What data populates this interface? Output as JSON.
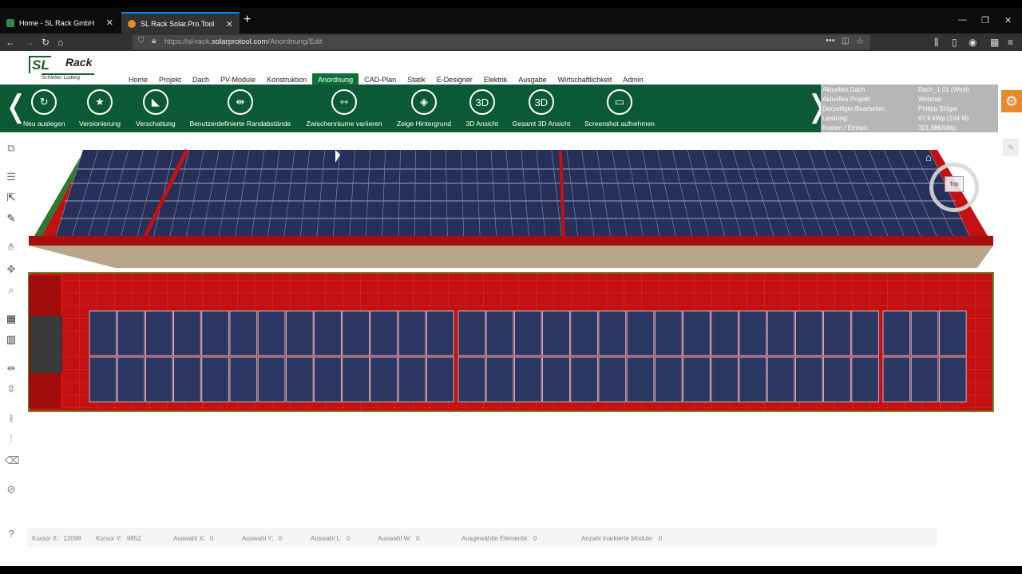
{
  "browser": {
    "tabs": [
      {
        "title": "Home - SL Rack GmbH",
        "close": "✕"
      },
      {
        "title": "SL Rack Solar.Pro.Tool",
        "close": "✕"
      }
    ],
    "new_tab": "+",
    "url_prefix": "https://sl-rack.",
    "url_domain": "solarprotool.com",
    "url_path": "/Anordnung/Edit"
  },
  "logo": {
    "brand": "SL",
    "brand2": "Rack",
    "sub": "Schletter Ludwig"
  },
  "menu": [
    "Home",
    "Projekt",
    "Dach",
    "PV-Module",
    "Konstruktion",
    "Anordnung",
    "CAD-Plan",
    "Statik",
    "E-Designer",
    "Elektrik",
    "Ausgabe",
    "Wirtschaftlichkeit",
    "Admin"
  ],
  "menu_active": "Anordnung",
  "toolbar": {
    "left_arrow": "❬",
    "right_arrow": "❭",
    "items": [
      {
        "label": "Neu auslegen",
        "icon": "refresh-icon",
        "glyph": "↻"
      },
      {
        "label": "Versionierung",
        "icon": "version-star-icon",
        "glyph": "★"
      },
      {
        "label": "Verschattung",
        "icon": "shading-icon",
        "glyph": "◣"
      },
      {
        "label": "Benutzerdefinierte Randabstände",
        "icon": "margin-icon",
        "glyph": "⇹"
      },
      {
        "label": "Zwischenräume variieren",
        "icon": "gap-icon",
        "glyph": "⇿"
      },
      {
        "label": "Zeige Hintergrund",
        "icon": "background-map-icon",
        "glyph": "◈"
      },
      {
        "label": "3D Ansicht",
        "icon": "3d-icon",
        "glyph": "3D"
      },
      {
        "label": "Gesamt 3D Ansicht",
        "icon": "3d-all-icon",
        "glyph": "3D"
      },
      {
        "label": "Screenshot aufnehmen",
        "icon": "monitor-icon",
        "glyph": "▭"
      }
    ]
  },
  "info": [
    {
      "k": "Aktuelles Dach",
      "v": "Dach_1 01 (West)"
    },
    {
      "k": "Aktuelles Projekt",
      "v": "Webinar"
    },
    {
      "k": "Derzeitiger Bearbeiter:",
      "v": "Philipp Stöger"
    },
    {
      "k": "Leistung:",
      "v": "67.9 kWp (194 M)"
    },
    {
      "k": "Kosten / Einheit:",
      "v": "301,88€/kWp"
    }
  ],
  "gear_glyph": "⚙",
  "viewcube": {
    "label": "Top"
  },
  "status": [
    {
      "k": "Kursor X:",
      "v": "12098"
    },
    {
      "k": "Kursor Y:",
      "v": "9852"
    },
    {
      "k": "Auswahl X:",
      "v": "0"
    },
    {
      "k": "Auswahl Y:",
      "v": "0"
    },
    {
      "k": "Auswahl L:",
      "v": "0"
    },
    {
      "k": "Auswahl W:",
      "v": "0"
    },
    {
      "k": "Ausgewählte Elemente:",
      "v": "0"
    },
    {
      "k": "Anzahl markierte Module:",
      "v": "0"
    }
  ],
  "help_glyph": "?",
  "colors": {
    "green": "#0b5a35",
    "roof_red": "#c41010",
    "panel": "#2a3560",
    "info_grey": "#b6b6b6",
    "gear_orange": "#e8892d"
  }
}
